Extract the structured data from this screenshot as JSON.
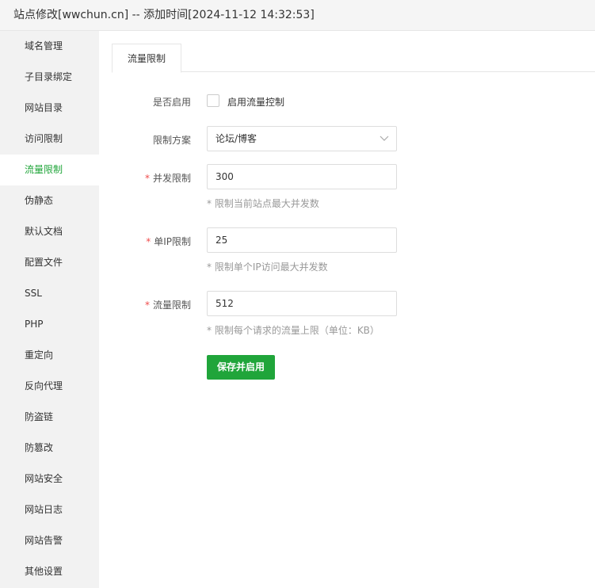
{
  "window": {
    "title": "站点修改[wwchun.cn] -- 添加时间[2024-11-12 14:32:53]"
  },
  "sidebar": {
    "active_color": "#20a53a",
    "items": [
      {
        "label": "域名管理"
      },
      {
        "label": "子目录绑定"
      },
      {
        "label": "网站目录"
      },
      {
        "label": "访问限制"
      },
      {
        "label": "流量限制",
        "active": true
      },
      {
        "label": "伪静态"
      },
      {
        "label": "默认文档"
      },
      {
        "label": "配置文件"
      },
      {
        "label": "SSL"
      },
      {
        "label": "PHP"
      },
      {
        "label": "重定向"
      },
      {
        "label": "反向代理"
      },
      {
        "label": "防盗链"
      },
      {
        "label": "防篡改"
      },
      {
        "label": "网站安全"
      },
      {
        "label": "网站日志"
      },
      {
        "label": "网站告警"
      },
      {
        "label": "其他设置"
      }
    ]
  },
  "main": {
    "tab": {
      "label": "流量限制"
    },
    "form": {
      "enable": {
        "label": "是否启用",
        "checkbox_label": "启用流量控制",
        "checked": false
      },
      "scheme": {
        "label": "限制方案",
        "value": "论坛/博客",
        "icon": "chevron-down-icon"
      },
      "concurrency": {
        "required_mark": "*",
        "label": "并发限制",
        "value": "300",
        "hint": "* 限制当前站点最大并发数"
      },
      "per_ip": {
        "required_mark": "*",
        "label": "单IP限制",
        "value": "25",
        "hint": "* 限制单个IP访问最大并发数"
      },
      "traffic": {
        "required_mark": "*",
        "label": "流量限制",
        "value": "512",
        "hint": "* 限制每个请求的流量上限（单位：KB）"
      }
    },
    "save_button": {
      "label": "保存并启用",
      "color": "#20a53a"
    }
  }
}
